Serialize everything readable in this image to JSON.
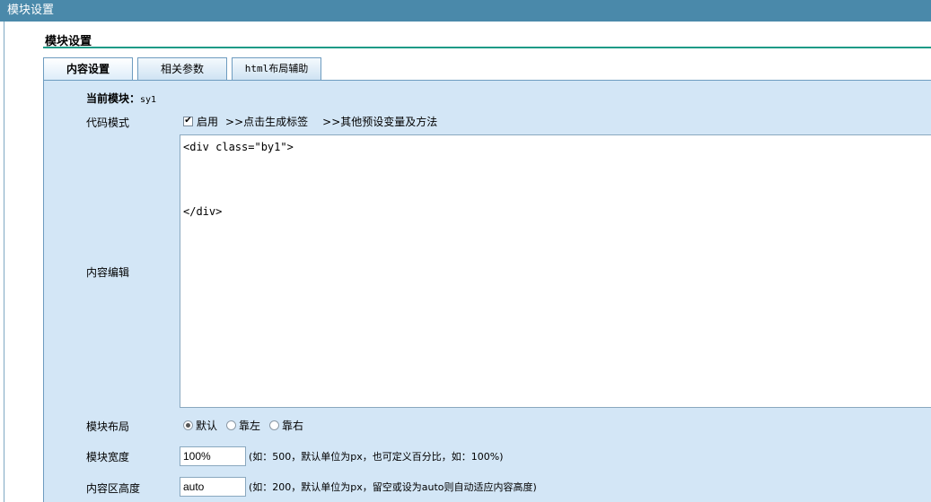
{
  "window": {
    "title": "模块设置"
  },
  "section": {
    "title": "模块设置"
  },
  "tabs": [
    {
      "label": "内容设置"
    },
    {
      "label": "相关参数"
    },
    {
      "label": "html布局辅助"
    }
  ],
  "current_module": {
    "label": "当前模块：",
    "value": "sy1"
  },
  "code_mode": {
    "label": "代码模式",
    "checkbox_label": "启用",
    "checked": true,
    "generate_link": ">>点击生成标签",
    "other_link": ">>其他预设变量及方法"
  },
  "content_edit": {
    "label": "内容编辑",
    "value": "<div class=\"by1\">\n\n\n\n</div>"
  },
  "layout": {
    "label": "模块布局",
    "options": [
      "默认",
      "靠左",
      "靠右"
    ],
    "selected": "默认"
  },
  "width": {
    "label": "模块宽度",
    "value": "100%",
    "hint": "(如：500，默认单位为px，也可定义百分比，如：100%)"
  },
  "height": {
    "label": "内容区高度",
    "value": "auto",
    "hint": "(如：200，默认单位为px，留空或设为auto则自动适应内容高度)"
  }
}
